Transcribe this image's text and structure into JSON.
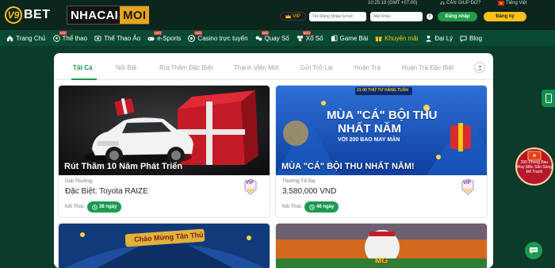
{
  "brand": {
    "logo_mark": "V9",
    "logo_text": "BET",
    "partner_a": "NHACAI",
    "partner_b": "MOI"
  },
  "topbar": {
    "clock": "10:25:19 (GMT +07:00)",
    "help": "CẦN GIÚP ĐỠ?",
    "language": "Tiếng Việt",
    "vip_label": "VIP",
    "user_placeholder": "Tên Đăng Nhập/ Email",
    "password_placeholder": "Mật Khẩu",
    "info": "!",
    "login": "Đăng nhập",
    "register": "Đăng ký"
  },
  "nav": {
    "new_badge": "MỚI",
    "items": [
      {
        "label": "Trang Chủ",
        "icon": "home-icon"
      },
      {
        "label": "Thể thao",
        "icon": "soccer-icon"
      },
      {
        "label": "Thể Thao Ảo",
        "icon": "virtual-sport-icon"
      },
      {
        "label": "e-Sports",
        "icon": "gamepad-icon"
      },
      {
        "label": "Casino trực tuyến",
        "icon": "casino-icon"
      },
      {
        "label": "Quay Số",
        "icon": "lottery-icon"
      },
      {
        "label": "Xổ Số",
        "icon": "lotto-icon"
      },
      {
        "label": "Game Bài",
        "icon": "cards-icon"
      },
      {
        "label": "Khuyến mãi",
        "icon": "gift-icon"
      },
      {
        "label": "Đại Lý",
        "icon": "agent-icon"
      },
      {
        "label": "Blog",
        "icon": "blog-icon"
      }
    ]
  },
  "tabs": [
    "Tất Cả",
    "Nổi Bật",
    "Rút Thăm Đặc Biệt",
    "Thành Viên Mới",
    "Gửi Trở Lại",
    "Hoàn Trả",
    "Hoàn Trả Đặc Biệt"
  ],
  "cards": [
    {
      "title": "Rút Thăm 10 Năm Phát Triển",
      "label": "Giải Thưởng:",
      "value": "Đặc Biệt: Toyota RAIZE",
      "end_label": "Kết Thúc:",
      "days": "38 ngày",
      "vip": "VIP"
    },
    {
      "title": "MÙA \"CÁ\" BỘI THU NHẤT NĂM!",
      "label": "Thưởng Tối Đa:",
      "value": "3,580,000 VND",
      "end_label": "Kết Thúc:",
      "days": "46 ngày",
      "vip": "VIP",
      "banner_small": "21:00 THỨ TƯ HÀNG TUẦN",
      "banner_line1": "MÙA \"CÁ\" BỘI THU",
      "banner_line2": "NHẤT NĂM",
      "banner_line3": "VỚI 200 BAO MAY MẮN"
    },
    {
      "banner": "Chào Mừng Tân Thủ"
    },
    {
      "banner": "MG"
    }
  ],
  "floating": {
    "promo": "200 Phong Bao May Mắn Sẵn Sàng Để Tranh",
    "chat_icon": "chat-icon",
    "phone_icon": "mobile-icon"
  },
  "colors": {
    "primary_green": "#1c9a52",
    "gold": "#ffc21a",
    "nav_bg": "#0a4a33",
    "page_bg": "#0c3a2b"
  }
}
